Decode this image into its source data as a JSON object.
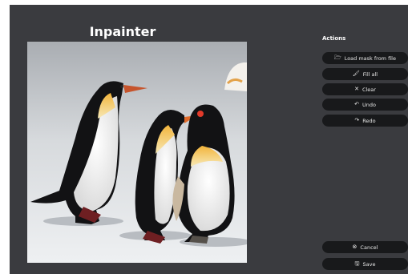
{
  "header": {
    "title": "Inpainter"
  },
  "actions": {
    "title": "Actions",
    "items": [
      {
        "label": "Load mask from file",
        "icon": "folder-icon",
        "glyph": "🗁"
      },
      {
        "label": "Fill all",
        "icon": "paint-roller-icon",
        "glyph": "🖌"
      },
      {
        "label": "Clear",
        "icon": "close-icon",
        "glyph": "✕"
      },
      {
        "label": "Undo",
        "icon": "undo-icon",
        "glyph": "↶"
      },
      {
        "label": "Redo",
        "icon": "redo-icon",
        "glyph": "↷"
      }
    ]
  },
  "footer": {
    "cancel": {
      "label": "Cancel",
      "icon": "cancel-icon",
      "glyph": "⊗"
    },
    "save": {
      "label": "Save",
      "icon": "save-icon",
      "glyph": "🖫"
    }
  },
  "colors": {
    "window_bg": "#3a3b3f",
    "button_bg": "#18191b",
    "text": "#ffffff"
  },
  "canvas": {
    "image": "penguins-photo",
    "description_icon": "image-canvas"
  }
}
